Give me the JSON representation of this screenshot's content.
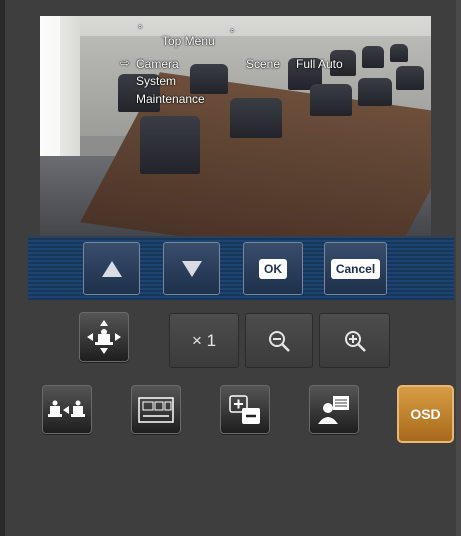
{
  "camera_view": {
    "osd_menu": {
      "title": "Top Menu",
      "title_marks": [
        "°",
        "°"
      ],
      "items": [
        {
          "label": "Camera",
          "selected": true,
          "value_label": "Scene",
          "value": "Full Auto"
        },
        {
          "label": "System"
        },
        {
          "label": "Maintenance"
        }
      ]
    }
  },
  "nav_bar": {
    "up_icon": "triangle-up-icon",
    "down_icon": "triangle-down-icon",
    "ok_label": "OK",
    "cancel_label": "Cancel"
  },
  "zoom_row": {
    "pan_tilt_icon": "pan-tilt-camera-icon",
    "zoom_level": "× 1",
    "zoom_out_icon": "zoom-out-icon",
    "zoom_in_icon": "zoom-in-icon"
  },
  "function_row": {
    "buttons": [
      {
        "icon": "camera-swap-icon"
      },
      {
        "icon": "preset-grid-icon"
      },
      {
        "icon": "plus-minus-icon"
      },
      {
        "icon": "user-panel-icon"
      },
      {
        "label": "OSD",
        "active": true
      }
    ]
  },
  "colors": {
    "osd_active": "#c58a34",
    "nav_bar": "#16365b",
    "background": "#3e3e3e"
  }
}
